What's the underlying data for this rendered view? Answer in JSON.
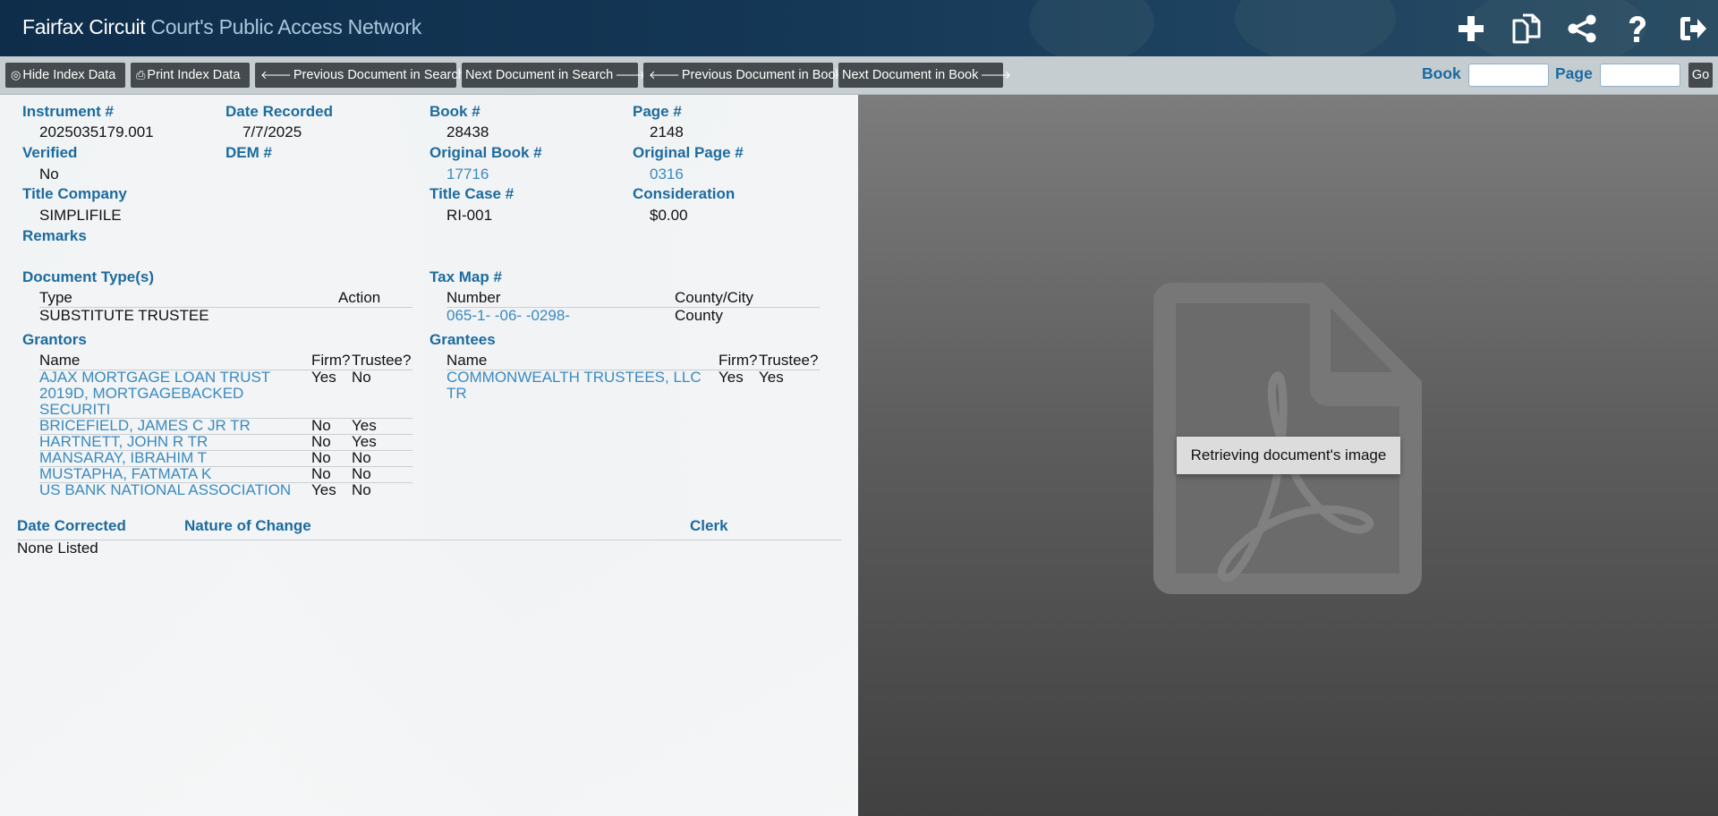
{
  "header": {
    "brand_main": "Fairfax Circuit",
    "brand_sub": "Court's Public Access Network",
    "icons": [
      "plus-icon",
      "copy-documents-icon",
      "share-icon",
      "help-icon",
      "logout-icon"
    ]
  },
  "toolbar": {
    "hide_index": "Hide Index Data",
    "print_index": "Print Index Data",
    "prev_search": "Previous Document in Search",
    "next_search": "Next Document in Search",
    "prev_book": "Previous Document in Book",
    "next_book": "Next Document in Book",
    "book_label": "Book",
    "book_value": "",
    "page_label": "Page",
    "page_value": "",
    "go": "Go"
  },
  "record": {
    "instrument_label": "Instrument #",
    "instrument": "2025035179.001",
    "date_recorded_label": "Date Recorded",
    "date_recorded": "7/7/2025",
    "book_label": "Book #",
    "book": "28438",
    "page_label": "Page #",
    "page": "2148",
    "verified_label": "Verified",
    "verified": "No",
    "dem_label": "DEM #",
    "original_book_label": "Original Book #",
    "original_book": "17716",
    "original_page_label": "Original Page #",
    "original_page": "0316",
    "title_company_label": "Title Company",
    "title_company": "SIMPLIFILE",
    "title_case_label": "Title Case #",
    "title_case": "RI-001",
    "consideration_label": "Consideration",
    "consideration": "$0.00",
    "remarks_label": "Remarks"
  },
  "document_types": {
    "label": "Document Type(s)",
    "col_type": "Type",
    "col_action": "Action",
    "rows": [
      {
        "type": "SUBSTITUTE TRUSTEE",
        "action": ""
      }
    ]
  },
  "tax_map": {
    "label": "Tax Map #",
    "col_number": "Number",
    "col_county": "County/City",
    "rows": [
      {
        "number": "065-1- -06- -0298-",
        "county": "County"
      }
    ]
  },
  "grantors": {
    "label": "Grantors",
    "col_name": "Name",
    "col_firm": "Firm?",
    "col_trustee": "Trustee?",
    "rows": [
      {
        "name_lines": [
          "AJAX MORTGAGE LOAN TRUST",
          "2019D, MORTGAGEBACKED",
          "SECURITI"
        ],
        "firm": "Yes",
        "trustee": "No"
      },
      {
        "name_lines": [
          "BRICEFIELD, JAMES C JR TR"
        ],
        "firm": "No",
        "trustee": "Yes"
      },
      {
        "name_lines": [
          "HARTNETT, JOHN R TR"
        ],
        "firm": "No",
        "trustee": "Yes"
      },
      {
        "name_lines": [
          "MANSARAY, IBRAHIM T"
        ],
        "firm": "No",
        "trustee": "No"
      },
      {
        "name_lines": [
          "MUSTAPHA, FATMATA K"
        ],
        "firm": "No",
        "trustee": "No"
      },
      {
        "name_lines": [
          "US BANK NATIONAL ASSOCIATION"
        ],
        "firm": "Yes",
        "trustee": "No"
      }
    ]
  },
  "grantees": {
    "label": "Grantees",
    "col_name": "Name",
    "col_firm": "Firm?",
    "col_trustee": "Trustee?",
    "rows": [
      {
        "name_lines": [
          "COMMONWEALTH TRUSTEES, LLC",
          "TR"
        ],
        "firm": "Yes",
        "trustee": "Yes"
      }
    ]
  },
  "corrections": {
    "col_date": "Date Corrected",
    "col_nature": "Nature of Change",
    "col_clerk": "Clerk",
    "empty_text": "None Listed"
  },
  "viewer": {
    "status": "Retrieving document's image",
    "icon": "pdf-document-icon"
  }
}
